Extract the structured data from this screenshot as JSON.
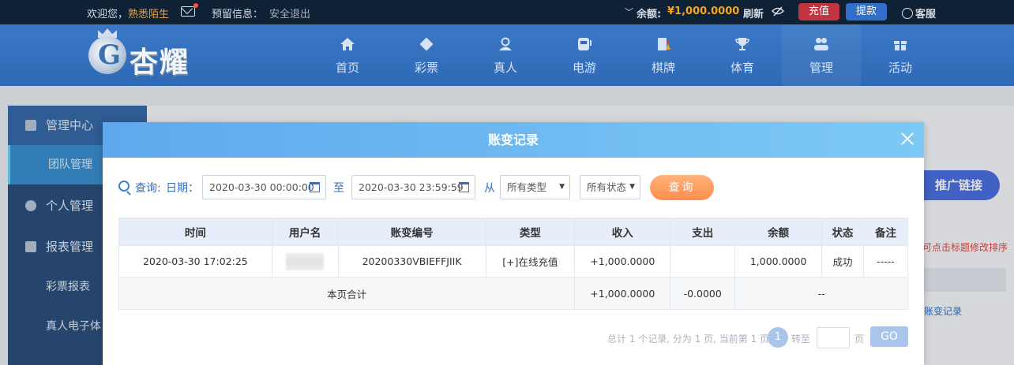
{
  "topbar": {
    "welcome": "欢迎您，",
    "username": "熟悉陌生",
    "reserved_info": "预留信息：",
    "logout": "安全退出",
    "balance_label": "余额:",
    "balance": "¥1,000.0000",
    "refresh": "刷新",
    "deposit": "充值",
    "withdraw": "提款",
    "customer_service": "客服",
    "colors": {
      "background": "#0f2135",
      "username": "#e6a23c",
      "balance": "#f5a623",
      "deposit": "#c0353f",
      "withdraw": "#2f6fc7"
    }
  },
  "logo": {
    "text": "杏耀"
  },
  "nav": {
    "items": [
      {
        "label": "首页",
        "icon": "home-icon"
      },
      {
        "label": "彩票",
        "icon": "lottery-icon"
      },
      {
        "label": "真人",
        "icon": "live-dealer-icon"
      },
      {
        "label": "电游",
        "icon": "slot-icon"
      },
      {
        "label": "棋牌",
        "icon": "cards-icon"
      },
      {
        "label": "体育",
        "icon": "trophy-icon"
      },
      {
        "label": "管理",
        "icon": "users-icon"
      },
      {
        "label": "活动",
        "icon": "gift-icon"
      }
    ],
    "active": "管理"
  },
  "sidebar": {
    "items": [
      {
        "label": "管理中心",
        "icon": "users-icon"
      },
      {
        "label": "团队管理"
      },
      {
        "label": "个人管理",
        "icon": "user-icon"
      },
      {
        "label": "报表管理",
        "icon": "report-icon"
      },
      {
        "label": "彩票报表"
      },
      {
        "label": "真人电子体"
      }
    ]
  },
  "background": {
    "promo_button": "推广链接",
    "sort_hint": "可点击标题修改排序",
    "link": "账变记录"
  },
  "modal": {
    "title": "账变记录",
    "filters": {
      "query_label": "查询:",
      "date_label": "日期：",
      "start": "2020-03-30 00:00:00",
      "to": "至",
      "end": "2020-03-30 23:59:59",
      "from": "从",
      "type_select": "所有类型",
      "status_select": "所有状态",
      "search_button": "查询"
    },
    "table": {
      "headers": [
        "时间",
        "用户名",
        "账变编号",
        "类型",
        "收入",
        "支出",
        "余额",
        "状态",
        "备注"
      ],
      "rows": [
        {
          "time": "2020-03-30 17:02:25",
          "code": "20200330VBIEFFJIIK",
          "type": "[+]在线充值",
          "income": "+1,000.0000",
          "expense": "",
          "balance": "1,000.0000",
          "status": "成功",
          "note": "-----"
        }
      ],
      "summary": {
        "label": "本页合计",
        "income": "+1,000.0000",
        "expense": "-0.0000",
        "balance": "--"
      }
    },
    "pager": {
      "info": "总计 1 个记录, 分为 1 页, 当前第 1 页",
      "current": "1",
      "jump": "转至",
      "page_word": "页",
      "go": "GO"
    }
  }
}
